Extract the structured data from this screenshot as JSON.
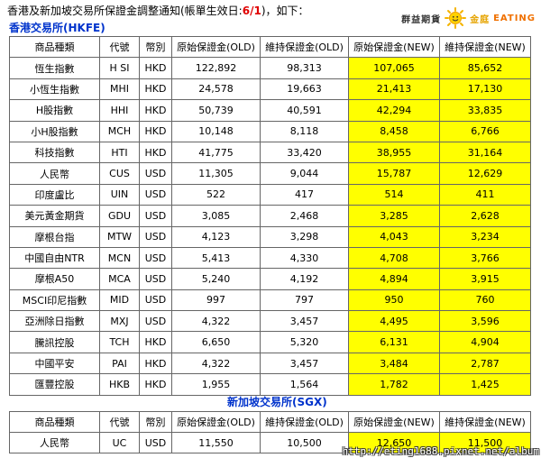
{
  "notice": {
    "prefix": "香港及新加坡交易所保證金調整通知(帳單生效日:",
    "date": "6/1",
    "suffix": ")，如下："
  },
  "brand": {
    "part1": "群益期貨",
    "part2": "金庭",
    "part3": "EATING"
  },
  "hkfe": {
    "title": "香港交易所(HKFE)",
    "headers": [
      "商品種類",
      "代號",
      "幣別",
      "原始保證金(OLD)",
      "維持保證金(OLD)",
      "原始保證金(NEW)",
      "維持保證金(NEW)"
    ],
    "rows": [
      [
        "恆生指數",
        "H SI",
        "HKD",
        "122,892",
        "98,313",
        "107,065",
        "85,652"
      ],
      [
        "小恆生指數",
        "MHI",
        "HKD",
        "24,578",
        "19,663",
        "21,413",
        "17,130"
      ],
      [
        "H股指數",
        "HHI",
        "HKD",
        "50,739",
        "40,591",
        "42,294",
        "33,835"
      ],
      [
        "小H股指數",
        "MCH",
        "HKD",
        "10,148",
        "8,118",
        "8,458",
        "6,766"
      ],
      [
        "科技指數",
        "HTI",
        "HKD",
        "41,775",
        "33,420",
        "38,955",
        "31,164"
      ],
      [
        "人民幣",
        "CUS",
        "USD",
        "11,305",
        "9,044",
        "15,787",
        "12,629"
      ],
      [
        "印度盧比",
        "UIN",
        "USD",
        "522",
        "417",
        "514",
        "411"
      ],
      [
        "美元黃金期貨",
        "GDU",
        "USD",
        "3,085",
        "2,468",
        "3,285",
        "2,628"
      ],
      [
        "摩根台指",
        "MTW",
        "USD",
        "4,123",
        "3,298",
        "4,043",
        "3,234"
      ],
      [
        "中國自由NTR",
        "MCN",
        "USD",
        "5,413",
        "4,330",
        "4,708",
        "3,766"
      ],
      [
        "摩根A50",
        "MCA",
        "USD",
        "5,240",
        "4,192",
        "4,894",
        "3,915"
      ],
      [
        "MSCI印尼指數",
        "MID",
        "USD",
        "997",
        "797",
        "950",
        "760"
      ],
      [
        "亞洲除日指數",
        "MXJ",
        "USD",
        "4,322",
        "3,457",
        "4,495",
        "3,596"
      ],
      [
        "騰訊控股",
        "TCH",
        "HKD",
        "6,650",
        "5,320",
        "6,131",
        "4,904"
      ],
      [
        "中國平安",
        "PAI",
        "HKD",
        "4,322",
        "3,457",
        "3,484",
        "2,787"
      ],
      [
        "匯豐控股",
        "HKB",
        "HKD",
        "1,955",
        "1,564",
        "1,782",
        "1,425"
      ]
    ]
  },
  "sgx": {
    "title": "新加坡交易所(SGX)",
    "headers": [
      "商品種類",
      "代號",
      "幣別",
      "原始保證金(OLD)",
      "維持保證金(OLD)",
      "原始保證金(NEW)",
      "維持保證金(NEW)"
    ],
    "rows": [
      [
        "人民幣",
        "UC",
        "USD",
        "11,550",
        "10,500",
        "12,650",
        "11,500"
      ]
    ]
  },
  "watermark": "http://eting1688.pixnet.net/album"
}
